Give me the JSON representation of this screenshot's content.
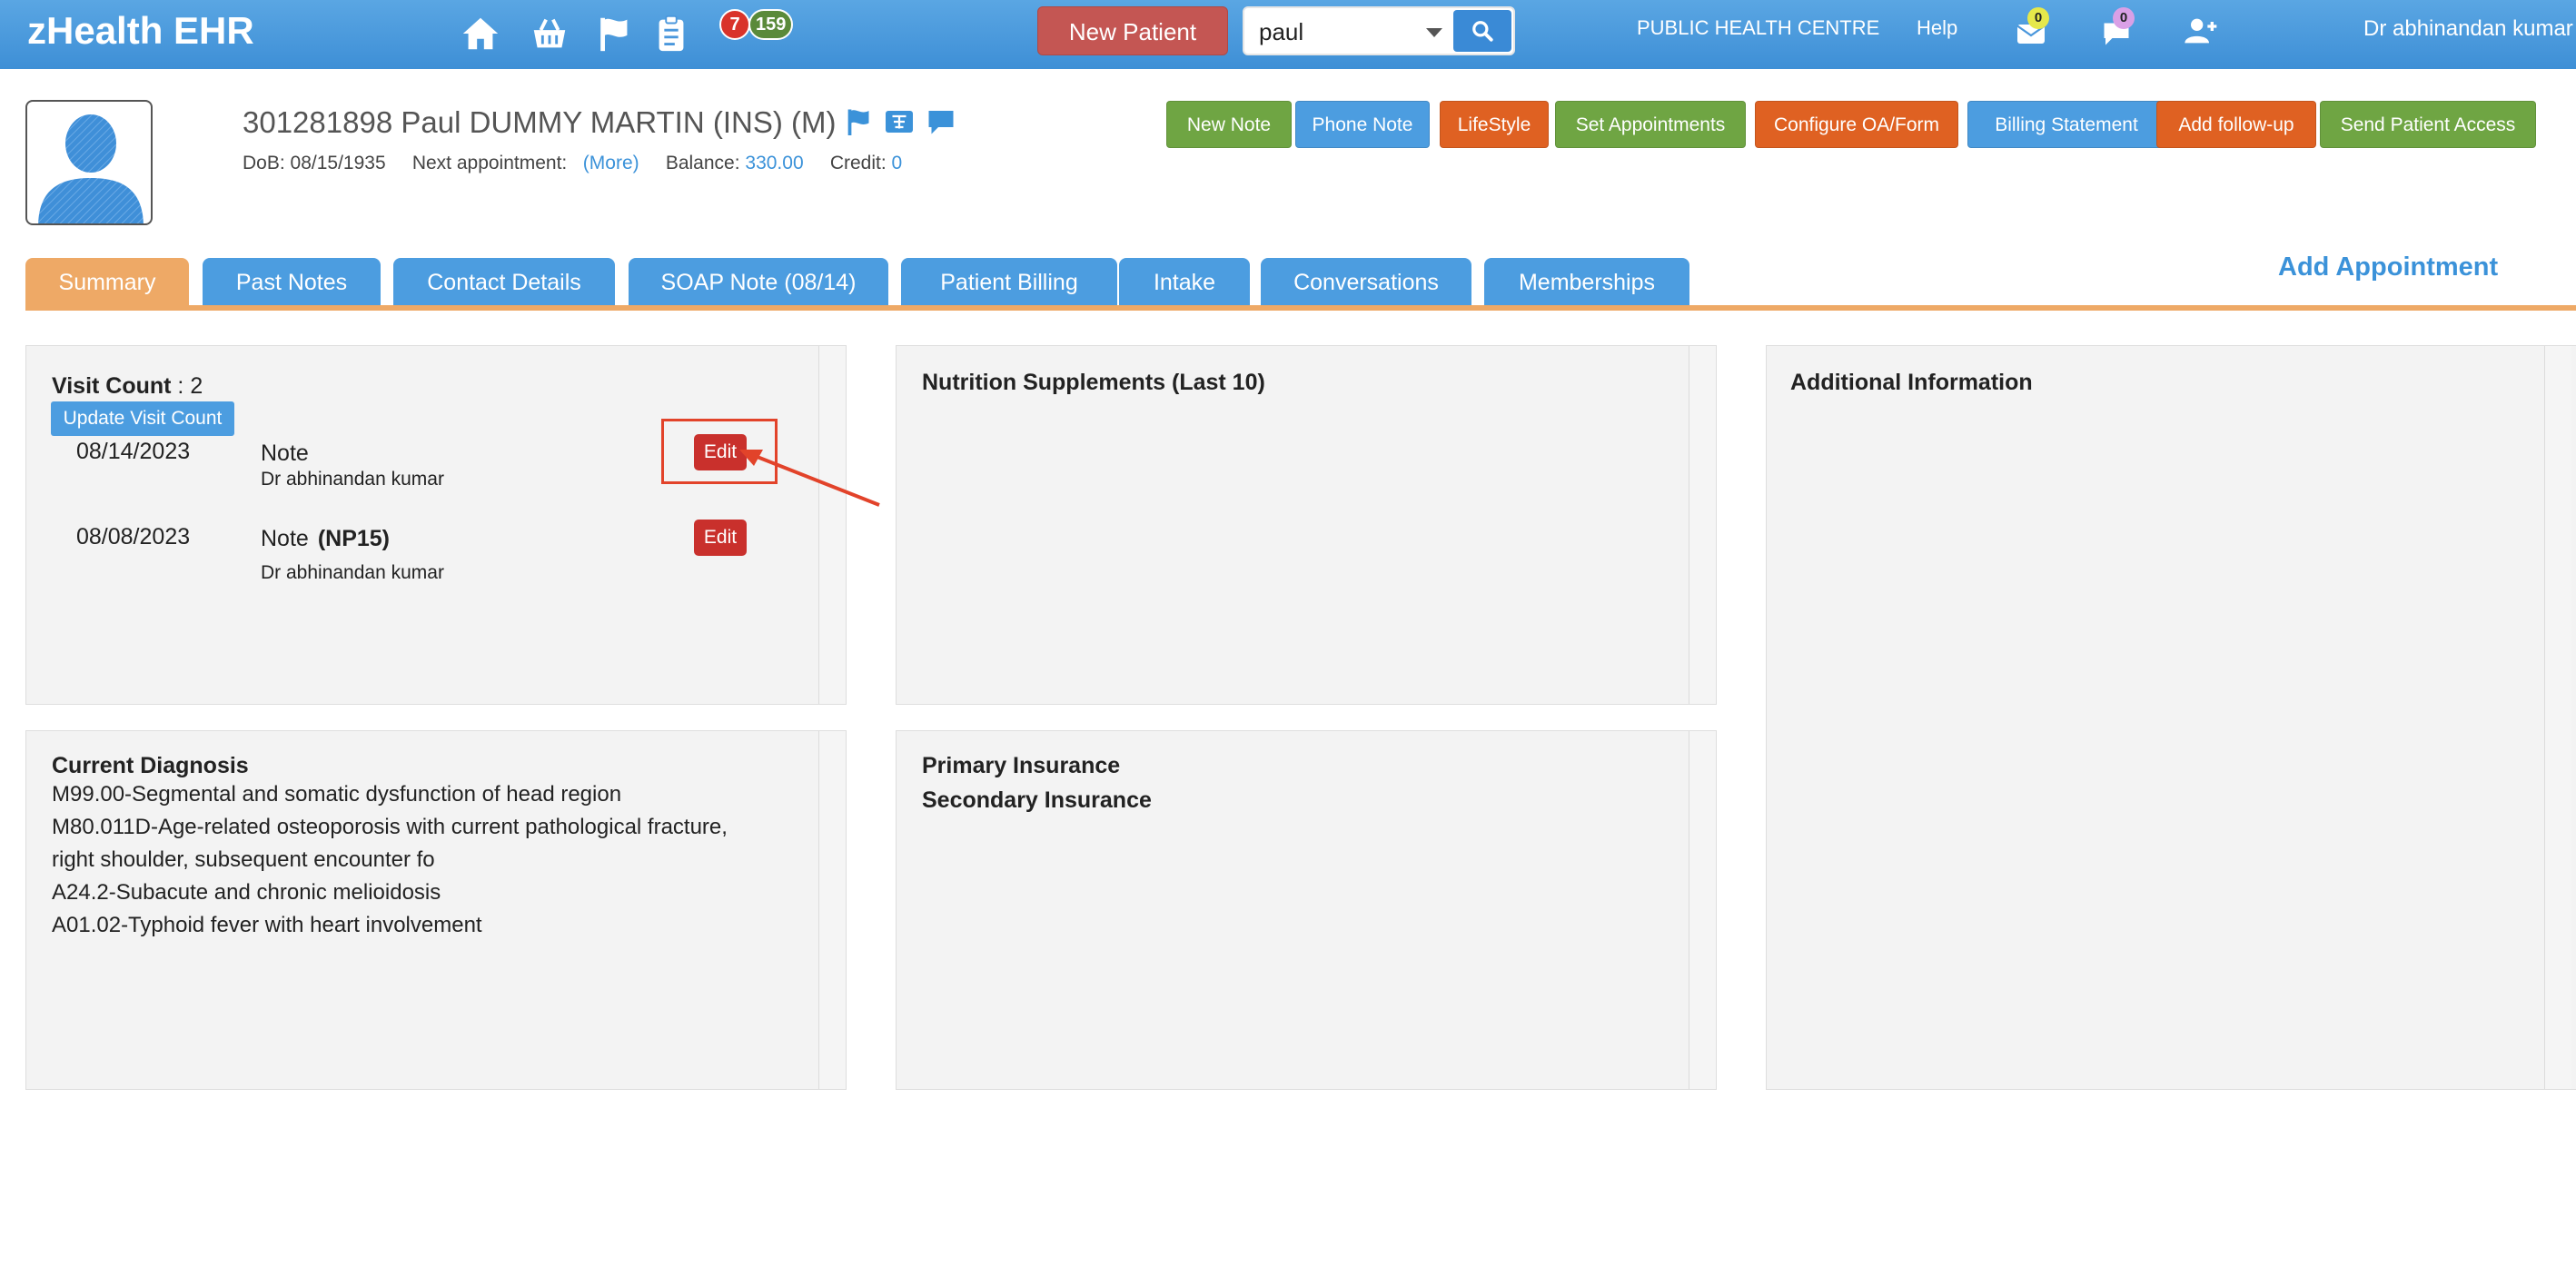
{
  "app": {
    "brand": "zHealth EHR",
    "badges": {
      "red": "7",
      "green": "159"
    },
    "new_patient_label": "New Patient",
    "search": {
      "value": "paul",
      "placeholder": ""
    },
    "clinic_name": "PUBLIC HEALTH CENTRE",
    "help_label": "Help",
    "mail_count": "0",
    "chat_count": "0",
    "user_name": "Dr abhinandan kumar"
  },
  "patient": {
    "title": "301281898 Paul DUMMY MARTIN  (INS) (M)",
    "dob_label": "DoB:",
    "dob": "08/15/1935",
    "next_appt_label": "Next appointment:",
    "next_appt_more": "(More)",
    "balance_label": "Balance:",
    "balance": "330.00",
    "credit_label": "Credit:",
    "credit": "0"
  },
  "actions": [
    "New Note",
    "Phone Note",
    "LifeStyle",
    "Set Appointments",
    "Configure OA/Form",
    "Billing Statement",
    "Add follow-up",
    "Send Patient Access"
  ],
  "tabs": [
    "Summary",
    "Past Notes",
    "Contact Details",
    "SOAP Note (08/14)",
    "Patient Billing",
    "Intake",
    "Conversations",
    "Memberships"
  ],
  "add_appointment_label": "Add Appointment",
  "visits": {
    "label": "Visit Count",
    "sep": " : ",
    "count": "2",
    "update_label": "Update Visit Count",
    "edit_label": "Edit",
    "items": [
      {
        "date": "08/14/2023",
        "type": "Note",
        "code": "",
        "doctor": "Dr abhinandan kumar"
      },
      {
        "date": "08/08/2023",
        "type": "Note",
        "code": "(NP15)",
        "doctor": "Dr abhinandan kumar"
      }
    ]
  },
  "nutrition_title": "Nutrition Supplements (Last 10)",
  "additional_title": "Additional Information",
  "diagnosis": {
    "title": "Current Diagnosis",
    "lines": [
      "M99.00-Segmental and somatic dysfunction of head region",
      "M80.011D-Age-related osteoporosis with current pathological fracture,",
      "right shoulder, subsequent encounter fo",
      "A24.2-Subacute and chronic melioidosis",
      "A01.02-Typhoid fever with heart involvement"
    ]
  },
  "insurance": {
    "primary": "Primary Insurance",
    "secondary": "Secondary Insurance"
  }
}
